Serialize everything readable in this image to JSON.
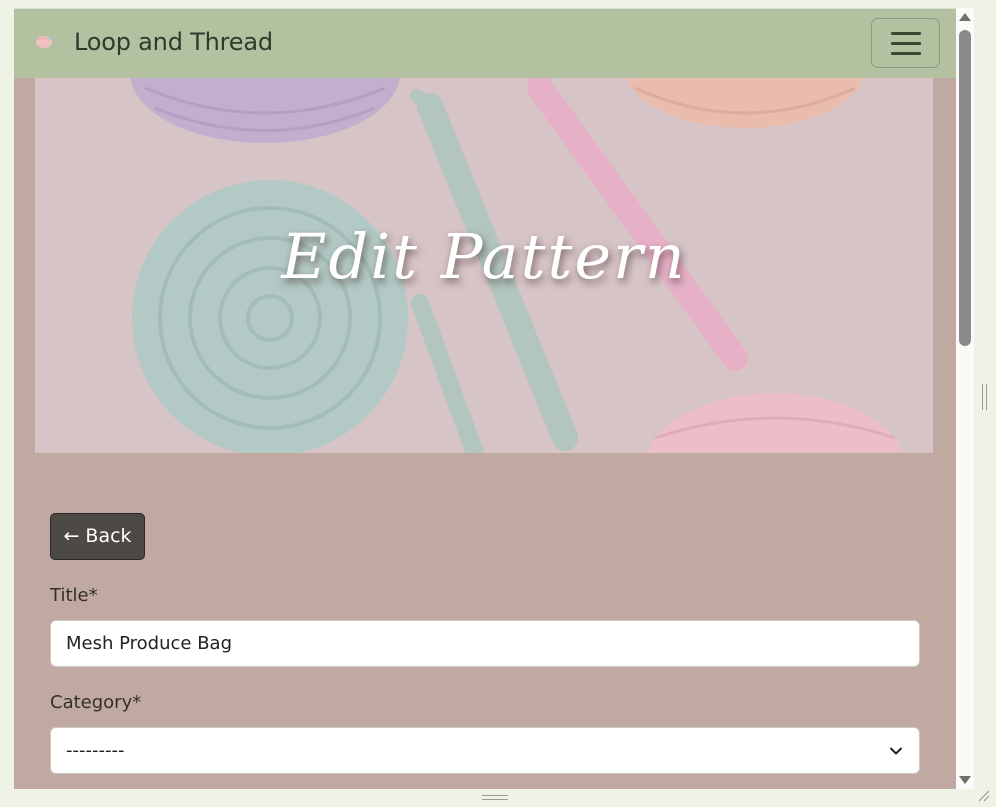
{
  "navbar": {
    "brand": "Loop and Thread"
  },
  "hero": {
    "title": "Edit Pattern"
  },
  "form": {
    "back_label": "← Back",
    "title_label": "Title*",
    "title_value": "Mesh Produce Bag",
    "category_label": "Category*",
    "category_value": "---------"
  },
  "colors": {
    "navbar": "#b3c1a1",
    "page_bg": "#c0a9a1",
    "back_button": "#4d4a45"
  }
}
